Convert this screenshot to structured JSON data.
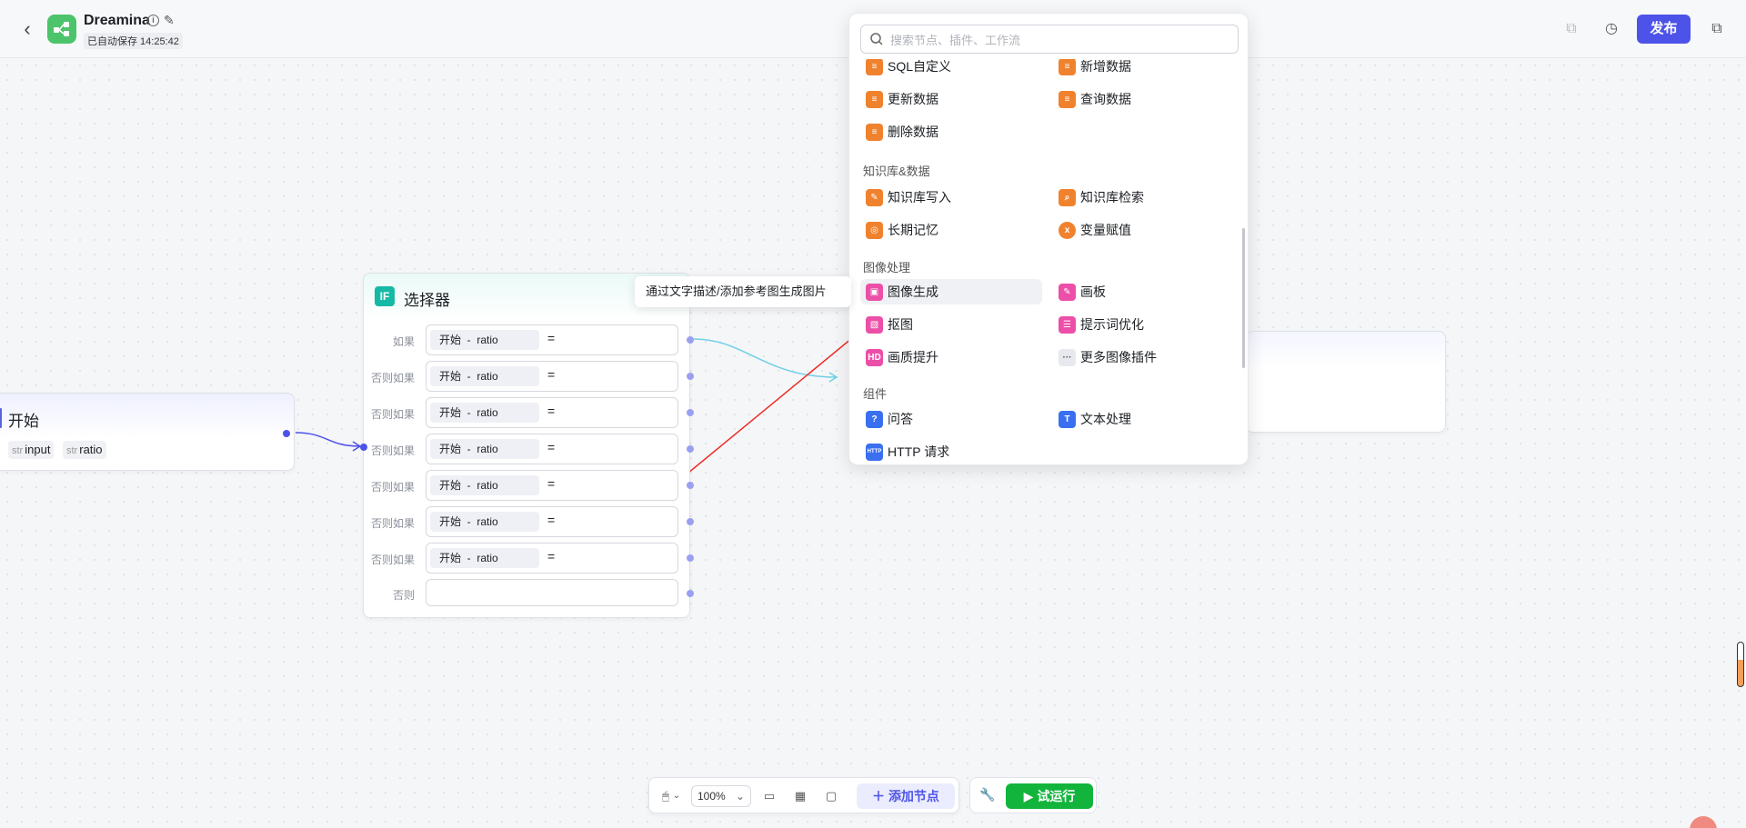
{
  "topbar": {
    "app_title": "Dreamina",
    "autosave": "已自动保存 14:25:42",
    "publish": "发布"
  },
  "start_node": {
    "title": "开始",
    "vars": [
      {
        "type": "str",
        "name": "input"
      },
      {
        "type": "str",
        "name": "ratio"
      }
    ]
  },
  "selector_node": {
    "icon": "IF",
    "title": "选择器",
    "conditions": [
      {
        "label": "如果",
        "var": "开始  -  ratio",
        "op": "="
      },
      {
        "label": "否则如果",
        "var": "开始  -  ratio",
        "op": "="
      },
      {
        "label": "否则如果",
        "var": "开始  -  ratio",
        "op": "="
      },
      {
        "label": "否则如果",
        "var": "开始  -  ratio",
        "op": "="
      },
      {
        "label": "否则如果",
        "var": "开始  -  ratio",
        "op": "="
      },
      {
        "label": "否则如果",
        "var": "开始  -  ratio",
        "op": "="
      },
      {
        "label": "否则如果",
        "var": "开始  -  ratio",
        "op": "="
      }
    ],
    "else_label": "否则"
  },
  "panel": {
    "search_placeholder": "搜索节点、插件、工作流",
    "items_top": [
      {
        "label": "SQL自定义",
        "color": "#f0822e"
      },
      {
        "label": "新增数据",
        "color": "#f0822e"
      },
      {
        "label": "更新数据",
        "color": "#f0822e"
      },
      {
        "label": "查询数据",
        "color": "#f0822e"
      },
      {
        "label": "删除数据",
        "color": "#f0822e"
      }
    ],
    "section_knowledge": "知识库&数据",
    "items_knowledge": [
      {
        "label": "知识库写入",
        "color": "#f0822e"
      },
      {
        "label": "知识库检索",
        "color": "#f0822e"
      },
      {
        "label": "长期记忆",
        "color": "#f0822e"
      },
      {
        "label": "变量赋值",
        "color": "#f0822e"
      }
    ],
    "section_image": "图像处理",
    "items_image": [
      {
        "label": "图像生成",
        "color": "#ec4fa8"
      },
      {
        "label": "画板",
        "color": "#ec4fa8"
      },
      {
        "label": "抠图",
        "color": "#ec4fa8"
      },
      {
        "label": "提示词优化",
        "color": "#ec4fa8"
      },
      {
        "label": "画质提升",
        "color": "#ec4fa8"
      },
      {
        "label": "更多图像插件",
        "color": "#e8e9ee"
      }
    ],
    "section_component": "组件",
    "items_component": [
      {
        "label": "问答",
        "color": "#3a6ff0"
      },
      {
        "label": "文本处理",
        "color": "#3a6ff0"
      },
      {
        "label": "HTTP 请求",
        "color": "#3a6ff0"
      }
    ]
  },
  "tooltip": "通过文字描述/添加参考图生成图片",
  "bottombar": {
    "zoom": "100%",
    "add_node": "添加节点",
    "run": "试运行"
  },
  "colors": {
    "accent": "#4d53e8",
    "run_green": "#13b43c",
    "annotation_arrow": "#ee2a24"
  }
}
